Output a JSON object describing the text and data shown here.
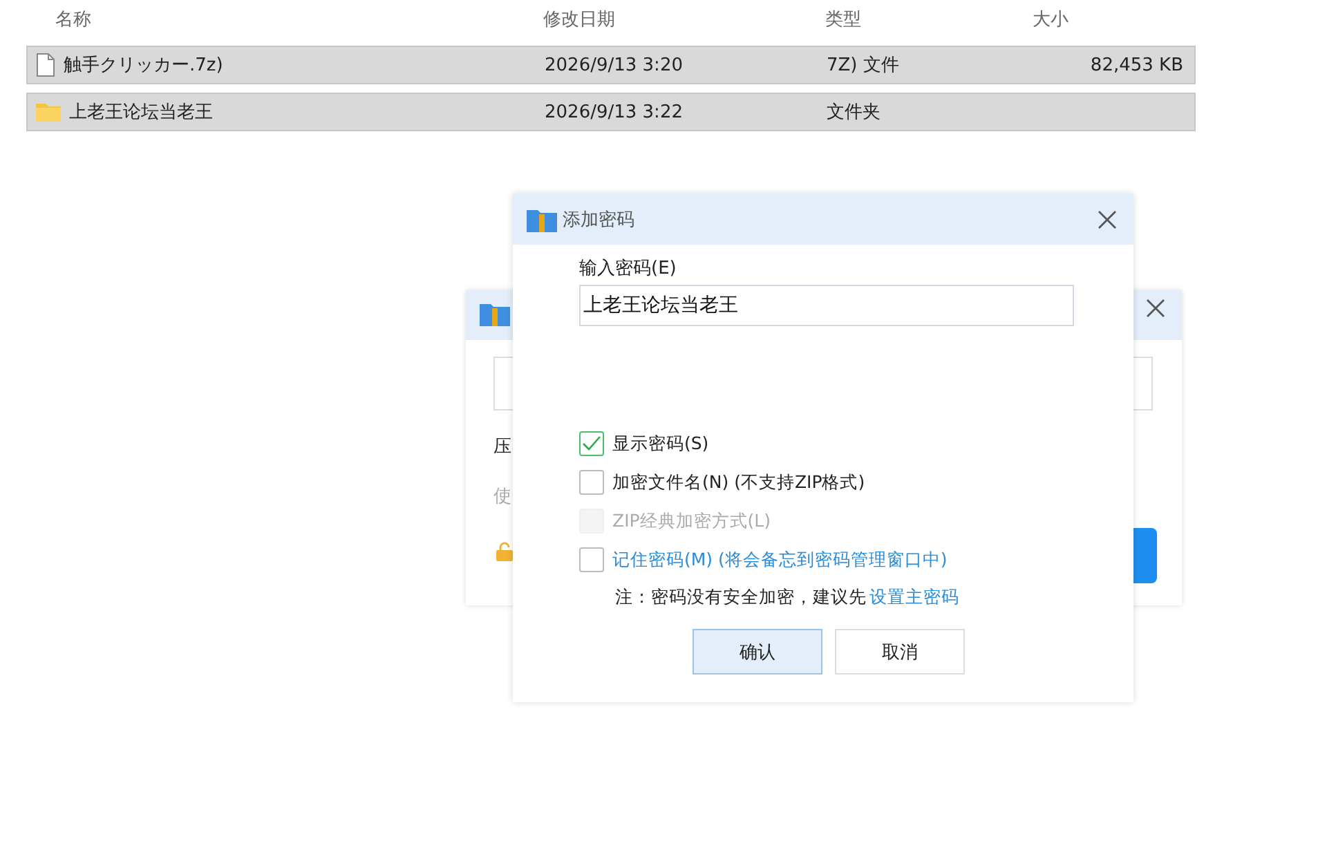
{
  "file_list": {
    "columns": [
      "名称",
      "修改日期",
      "类型",
      "大小"
    ],
    "rows": [
      {
        "kind": "file",
        "name": "触手クリッカー.7z)",
        "date": "2026/9/13 3:20",
        "type": "7Z)  文件",
        "size": "82,453 KB",
        "selected": true
      },
      {
        "kind": "folder",
        "name": "上老王论坛当老王",
        "date": "2026/9/13 3:22",
        "type": "文件夹",
        "selected": true
      }
    ]
  },
  "back_dialog": {
    "line_1": "压",
    "line_2": "使"
  },
  "dialog": {
    "title": "添加密码",
    "password_label": "输入密码(E)",
    "password_value": "上老王论坛当老王",
    "options": [
      {
        "kind": "plain",
        "label": "显示密码(S)",
        "checked": true,
        "disabled": false
      },
      {
        "kind": "plain",
        "label": "加密文件名(N) (不支持ZIP格式)",
        "checked": false,
        "disabled": false
      },
      {
        "kind": "plain",
        "label": "ZIP经典加密方式(L)",
        "checked": false,
        "disabled": true
      },
      {
        "kind": "link",
        "label": "记住密码(M) (将会备忘到密码管理窗口中)",
        "checked": false,
        "disabled": false
      }
    ],
    "note": "注：密码没有安全加密，建议先",
    "note_link": "设置主密码",
    "buttons": [
      {
        "label": "确认",
        "selected": true
      },
      {
        "label": "取消",
        "selected": false
      }
    ]
  }
}
